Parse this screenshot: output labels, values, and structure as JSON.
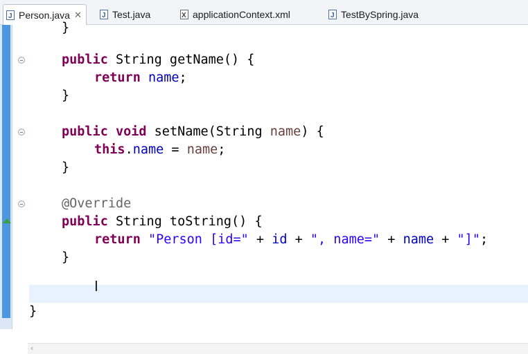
{
  "tabs": [
    {
      "label": "Person.java",
      "icon": "java-file-icon",
      "active": true,
      "close": "✕"
    },
    {
      "label": "Test.java",
      "icon": "java-file-icon",
      "active": false
    },
    {
      "label": "applicationContext.xml",
      "icon": "xml-file-icon",
      "active": false
    },
    {
      "label": "TestBySpring.java",
      "icon": "java-file-icon",
      "active": false
    }
  ],
  "code": {
    "top_brace": "}",
    "getName": {
      "kw_public": "public",
      "sig": " String getName() {",
      "kw_return": "return",
      "field_name": "name",
      "semi": ";",
      "close": "}"
    },
    "setName": {
      "kw_public": "public",
      "kw_void": "void",
      "sig1": " setName(String ",
      "param_name": "name",
      "sig2": ") {",
      "kw_this": "this",
      "dot": ".",
      "field_name": "name",
      "assign": " = ",
      "param_ref": "name",
      "semi": ";",
      "close": "}"
    },
    "toString": {
      "annotation": "@Override",
      "kw_public": "public",
      "sig": " String toString() {",
      "kw_return": "return",
      "str1": "\"Person [id=\"",
      "plus1": " + ",
      "field_id": "id",
      "plus2": " + ",
      "str2": "\", name=\"",
      "plus3": " + ",
      "field_name": "name",
      "plus4": " + ",
      "str3": "\"]\"",
      "semi": ";",
      "close": "}"
    },
    "class_close": "}"
  },
  "colors": {
    "keyword": "#7f0055",
    "field": "#0000c0",
    "string": "#2a00ff",
    "annotation": "#646464",
    "ruler_blue": "#4a97e2",
    "current_line": "#e8f2fe"
  },
  "scrollbar_glyph": "‹",
  "cursor_glyph": "I"
}
